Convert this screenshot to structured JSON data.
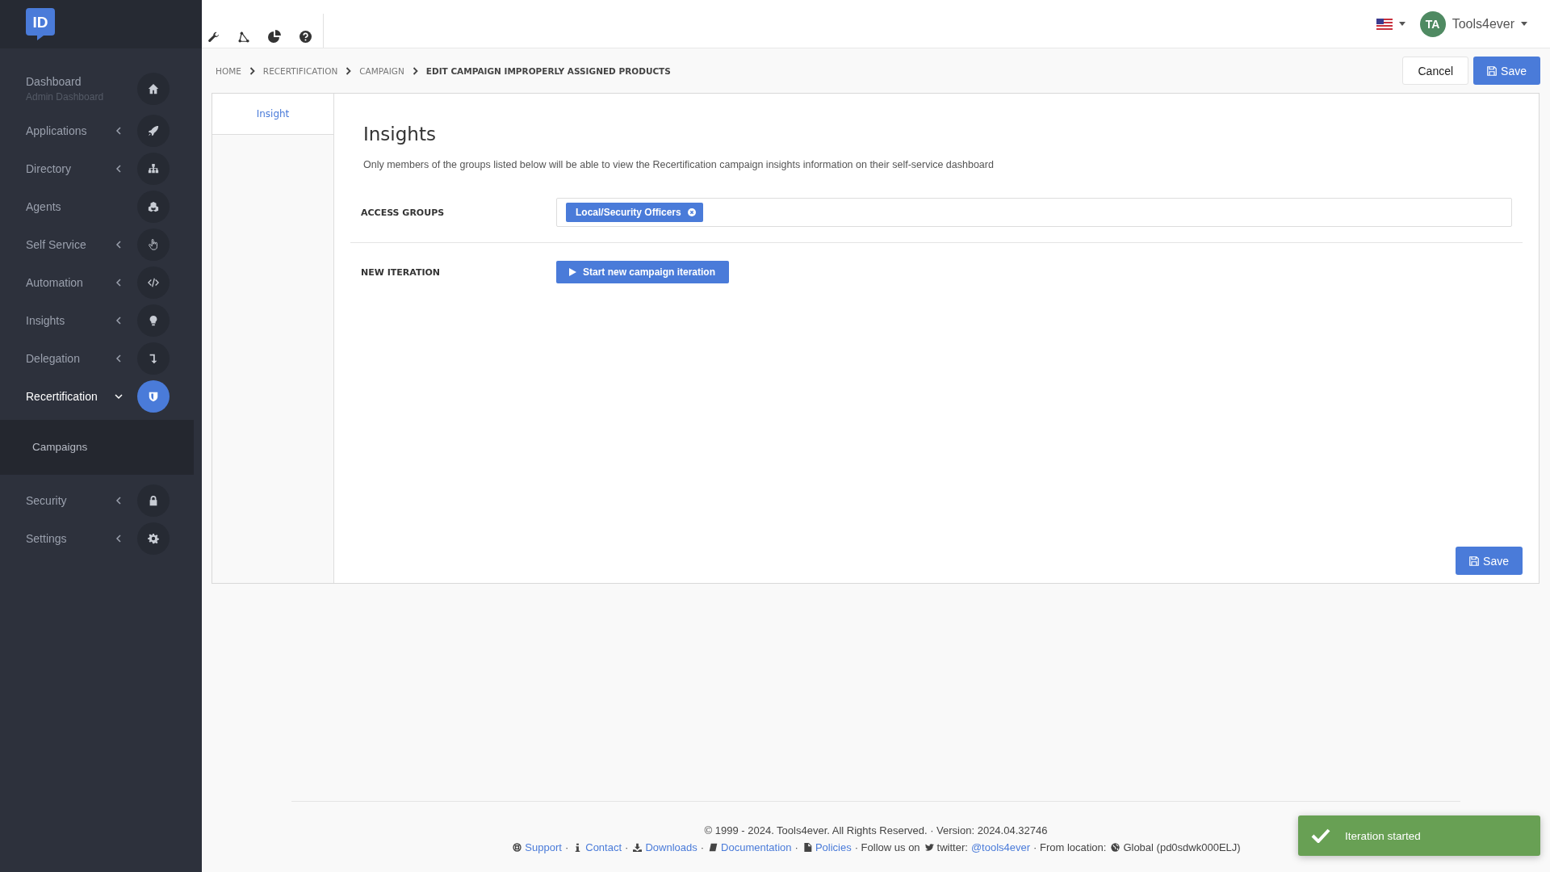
{
  "sidebar": {
    "logo": "ID",
    "items": [
      {
        "label": "Dashboard",
        "subtitle": "Admin Dashboard",
        "has_submenu": false,
        "selected": false
      },
      {
        "label": "Applications",
        "has_submenu": true,
        "expanded": false,
        "selected": false
      },
      {
        "label": "Directory",
        "has_submenu": true,
        "expanded": false,
        "selected": false
      },
      {
        "label": "Agents",
        "has_submenu": false,
        "selected": false
      },
      {
        "label": "Self Service",
        "has_submenu": true,
        "expanded": false,
        "selected": false
      },
      {
        "label": "Automation",
        "has_submenu": true,
        "expanded": false,
        "selected": false
      },
      {
        "label": "Insights",
        "has_submenu": true,
        "expanded": false,
        "selected": false
      },
      {
        "label": "Delegation",
        "has_submenu": true,
        "expanded": false,
        "selected": false
      },
      {
        "label": "Recertification",
        "has_submenu": true,
        "expanded": true,
        "selected": true,
        "children": [
          {
            "label": "Campaigns",
            "selected": false
          }
        ]
      },
      {
        "label": "Security",
        "has_submenu": true,
        "expanded": false,
        "selected": false
      },
      {
        "label": "Settings",
        "has_submenu": true,
        "expanded": false,
        "selected": false
      }
    ]
  },
  "topbar": {
    "avatar": "TA",
    "user": "Tools4ever"
  },
  "breadcrumb": [
    "HOME",
    "RECERTIFICATION",
    "CAMPAIGN",
    "EDIT CAMPAIGN IMPROPERLY ASSIGNED PRODUCTS"
  ],
  "header_buttons": {
    "cancel": "Cancel",
    "save": "Save"
  },
  "tabs": [
    {
      "label": "Insight",
      "selected": true
    }
  ],
  "section": {
    "title": "Insights",
    "description": "Only members of the groups listed below will be able to view the Recertification campaign insights information on their self-service dashboard",
    "access_groups": {
      "label": "ACCESS GROUPS",
      "tags": [
        "Local/Security Officers"
      ]
    },
    "new_iteration": {
      "label": "NEW ITERATION",
      "button": "Start new campaign iteration"
    },
    "save": "Save"
  },
  "footer": {
    "copyright": "© 1999 - 2024. Tools4ever. All Rights Reserved. · Version: 2024.04.32746",
    "segments": [
      {
        "kind": "link",
        "text": "Support"
      },
      {
        "kind": "sep",
        "text": "·"
      },
      {
        "kind": "link",
        "text": "Contact"
      },
      {
        "kind": "sep",
        "text": "·"
      },
      {
        "kind": "link",
        "text": "Downloads"
      },
      {
        "kind": "sep",
        "text": "·"
      },
      {
        "kind": "link",
        "text": "Documentation"
      },
      {
        "kind": "sep",
        "text": "·"
      },
      {
        "kind": "link",
        "text": "Policies"
      },
      {
        "kind": "text",
        "text": "· Follow us on"
      },
      {
        "kind": "text",
        "text": "twitter:"
      },
      {
        "kind": "link",
        "text": "@tools4ever"
      },
      {
        "kind": "text",
        "text": "· From location:"
      },
      {
        "kind": "text",
        "text": "Global (pd0sdwk000ELJ)"
      }
    ]
  },
  "toast": {
    "message": "Iteration started"
  }
}
